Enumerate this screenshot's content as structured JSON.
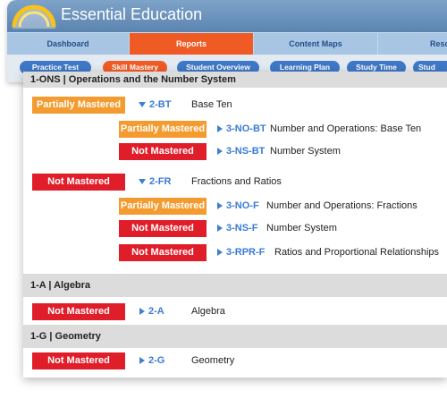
{
  "app": {
    "title": "Essential Education"
  },
  "nav": {
    "tabs": [
      {
        "label": "Dashboard",
        "active": false
      },
      {
        "label": "Reports",
        "active": true
      },
      {
        "label": "Content Maps",
        "active": false
      },
      {
        "label": "Resou",
        "active": false
      }
    ],
    "subtabs": [
      {
        "label": "Practice Test",
        "active": false
      },
      {
        "label": "Skill Mastery",
        "active": true
      },
      {
        "label": "Student Overview",
        "active": false
      },
      {
        "label": "Learning Plan",
        "active": false
      },
      {
        "label": "Study Time",
        "active": false
      },
      {
        "label": "Stud",
        "active": false
      }
    ]
  },
  "colors": {
    "accent": "#f05a24",
    "partially_mastered": "#f39b2f",
    "not_mastered": "#e01e2a",
    "link": "#3a7bd5"
  },
  "sections": [
    {
      "title": "1-ONS | Operations and the Number System",
      "rows": [
        {
          "status": "Partially Mastered",
          "code": "2-BT",
          "name": "Base Ten",
          "expanded": true,
          "children": [
            {
              "status": "Partially Mastered",
              "code": "3-NO-BT",
              "name": "Number and Operations: Base Ten"
            },
            {
              "status": "Not Mastered",
              "code": "3-NS-BT",
              "name": "Number System"
            }
          ]
        },
        {
          "status": "Not Mastered",
          "code": "2-FR",
          "name": "Fractions and Ratios",
          "expanded": true,
          "children": [
            {
              "status": "Partially Mastered",
              "code": "3-NO-F",
              "name": "Number and Operations: Fractions"
            },
            {
              "status": "Not Mastered",
              "code": "3-NS-F",
              "name": "Number System"
            },
            {
              "status": "Not Mastered",
              "code": "3-RPR-F",
              "name": "Ratios and Proportional Relationships"
            }
          ]
        }
      ]
    },
    {
      "title": "1-A | Algebra",
      "rows": [
        {
          "status": "Not Mastered",
          "code": "2-A",
          "name": "Algebra",
          "expanded": false
        }
      ]
    },
    {
      "title": "1-G | Geometry",
      "rows": [
        {
          "status": "Not Mastered",
          "code": "2-G",
          "name": "Geometry",
          "expanded": false
        }
      ]
    }
  ]
}
